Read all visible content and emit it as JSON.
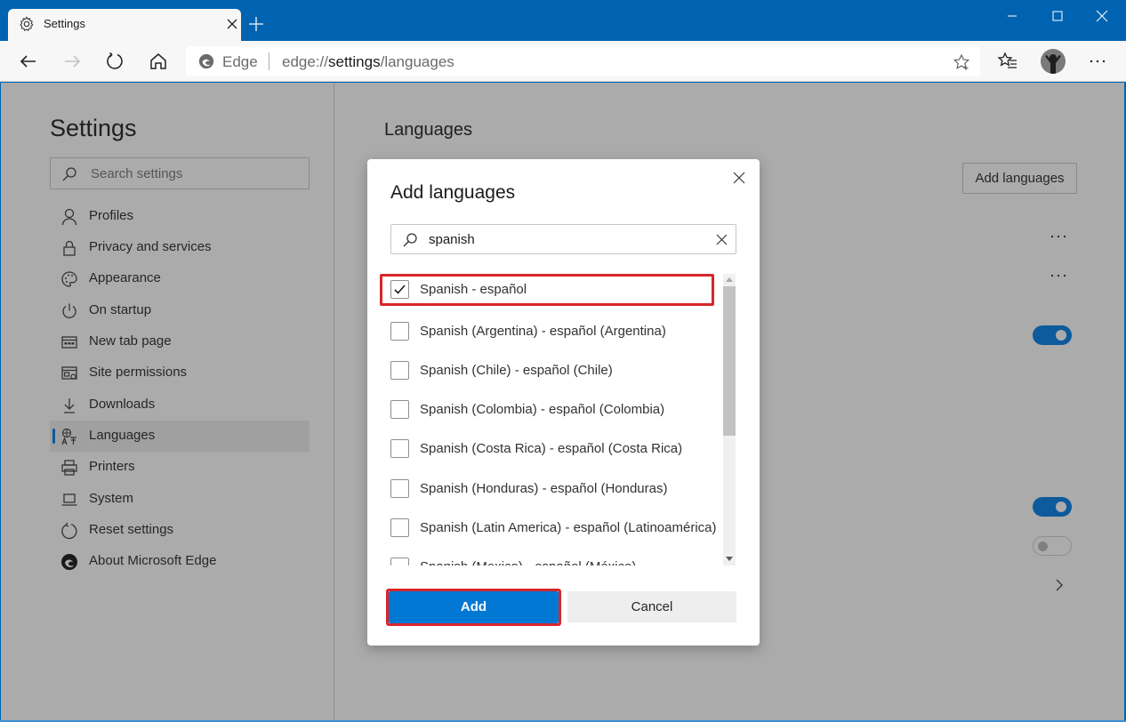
{
  "browser": {
    "tab": {
      "title": "Settings",
      "icon": "gear-icon"
    },
    "window_controls": [
      "minimize-icon",
      "maximize-icon",
      "close-icon"
    ],
    "address_bar": {
      "site_label": "Edge",
      "url_prefix": "edge://",
      "url_host": "settings",
      "url_path": "/languages"
    },
    "toolbar_icons": [
      "back-icon",
      "forward-icon",
      "refresh-icon",
      "home-icon",
      "favorite-star-icon",
      "favorites-list-icon",
      "profile-avatar",
      "more-icon"
    ]
  },
  "sidebar": {
    "title": "Settings",
    "search_placeholder": "Search settings",
    "items": [
      {
        "label": "Profiles",
        "icon": "person-icon",
        "active": false
      },
      {
        "label": "Privacy and services",
        "icon": "lock-icon",
        "active": false
      },
      {
        "label": "Appearance",
        "icon": "palette-icon",
        "active": false
      },
      {
        "label": "On startup",
        "icon": "power-icon",
        "active": false
      },
      {
        "label": "New tab page",
        "icon": "new-tab-icon",
        "active": false
      },
      {
        "label": "Site permissions",
        "icon": "site-permissions-icon",
        "active": false
      },
      {
        "label": "Downloads",
        "icon": "download-icon",
        "active": false
      },
      {
        "label": "Languages",
        "icon": "languages-icon",
        "active": true
      },
      {
        "label": "Printers",
        "icon": "printer-icon",
        "active": false
      },
      {
        "label": "System",
        "icon": "laptop-icon",
        "active": false
      },
      {
        "label": "Reset settings",
        "icon": "reset-icon",
        "active": false
      },
      {
        "label": "About Microsoft Edge",
        "icon": "edge-logo-icon",
        "active": false
      }
    ]
  },
  "main": {
    "title": "Languages",
    "add_languages_button": "Add languages",
    "toggles": [
      {
        "state": "on"
      },
      {
        "state": "on"
      },
      {
        "state": "off"
      }
    ]
  },
  "dialog": {
    "title": "Add languages",
    "search_value": "spanish",
    "languages": [
      {
        "label": "Spanish - español",
        "checked": true
      },
      {
        "label": "Spanish (Argentina) - español (Argentina)",
        "checked": false
      },
      {
        "label": "Spanish (Chile) - español (Chile)",
        "checked": false
      },
      {
        "label": "Spanish (Colombia) - español (Colombia)",
        "checked": false
      },
      {
        "label": "Spanish (Costa Rica) - español (Costa Rica)",
        "checked": false
      },
      {
        "label": "Spanish (Honduras) - español (Honduras)",
        "checked": false
      },
      {
        "label": "Spanish (Latin America) - español (Latinoamérica)",
        "checked": false
      },
      {
        "label": "Spanish (Mexico) - español (México)",
        "checked": false
      }
    ],
    "add_button": "Add",
    "cancel_button": "Cancel",
    "highlight_color": "#d7262c",
    "accent_color": "#0078d4"
  }
}
